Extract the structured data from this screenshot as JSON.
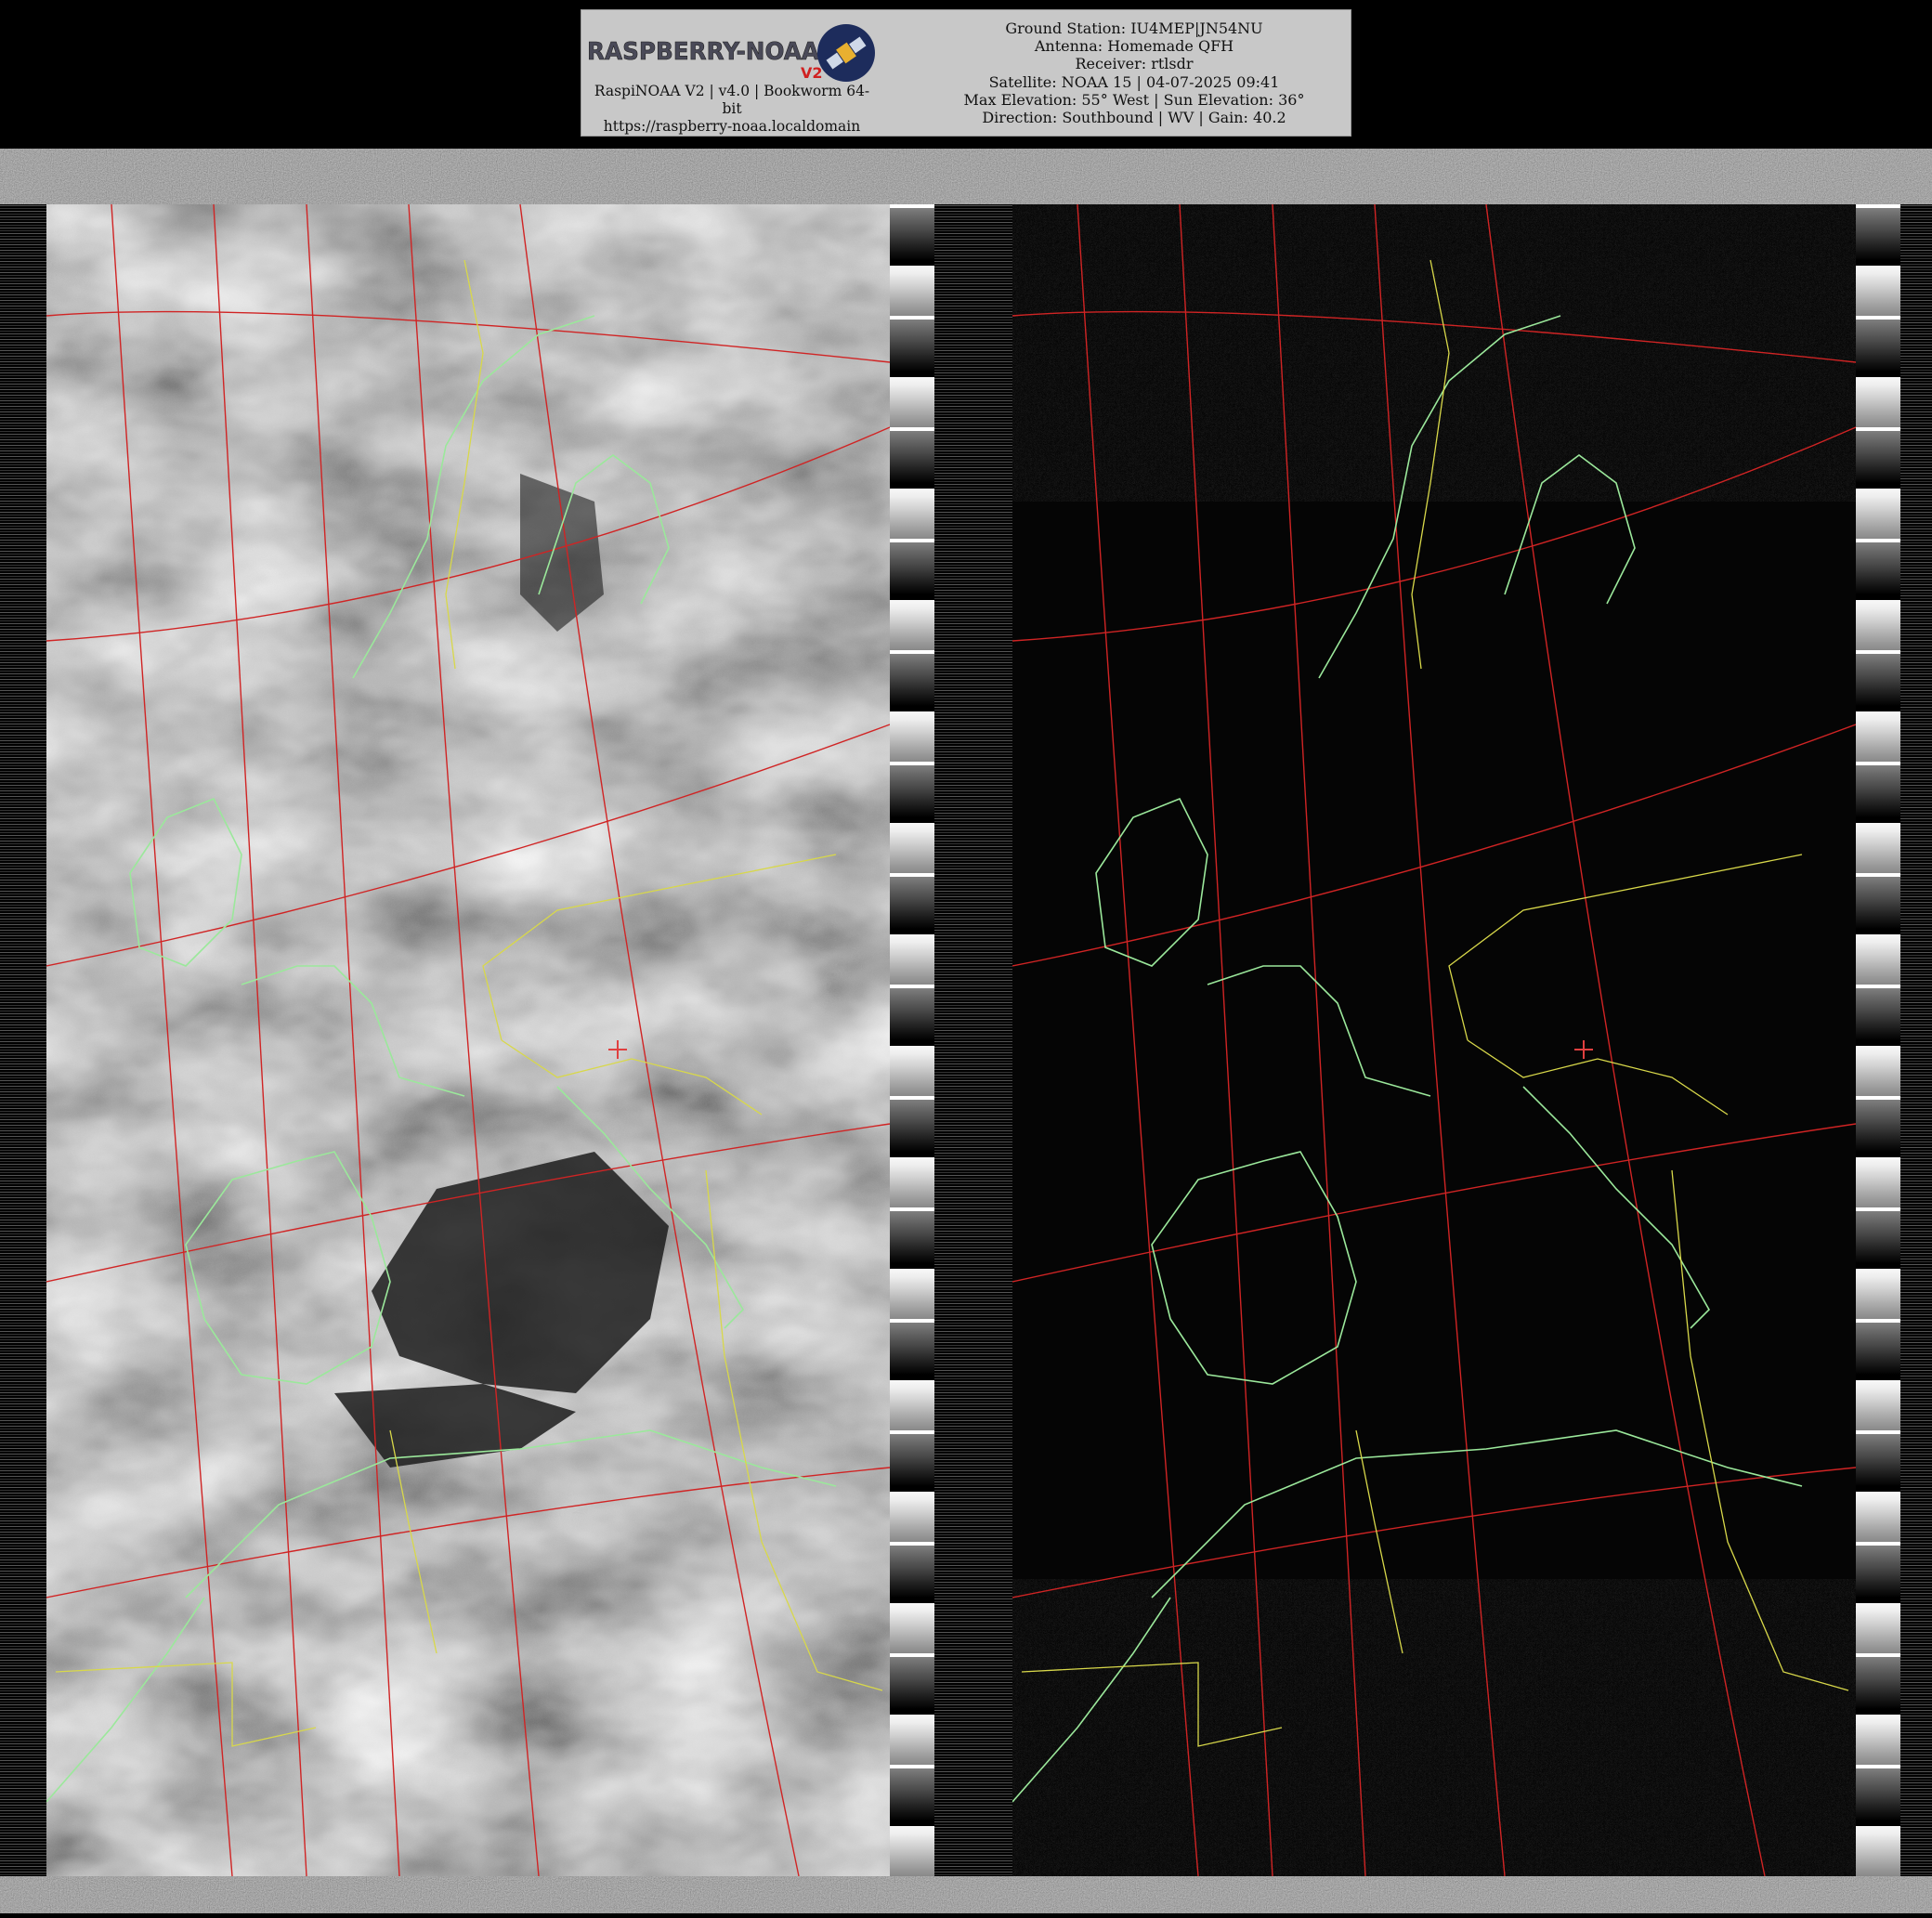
{
  "header": {
    "logo_text": "RASPBERRY-NOAA",
    "logo_badge": "V2",
    "left_lines": [
      "RaspiNOAA V2 | v4.0 | Bookworm 64-bit",
      "https://raspberry-noaa.localdomain"
    ],
    "right_lines": [
      "Ground Station: IU4MEP|JN54NU",
      "Antenna: Homemade QFH",
      "Receiver: rtlsdr",
      "Satellite: NOAA 15 | 04-07-2025 09:41",
      "Max Elevation: 55° West | Sun Elevation: 36°",
      "Direction: Southbound | WV | Gain: 40.2"
    ]
  },
  "imagery": {
    "channels": [
      {
        "id": "visible",
        "appearance": "grayscale cloud imagery"
      },
      {
        "id": "infrared",
        "appearance": "mostly black with noise bands"
      }
    ],
    "overlay_colors": {
      "coastlines": "#9be89b",
      "borders": "#d8d84a",
      "graticule": "#d02424",
      "center_marker": "#e04040"
    }
  }
}
